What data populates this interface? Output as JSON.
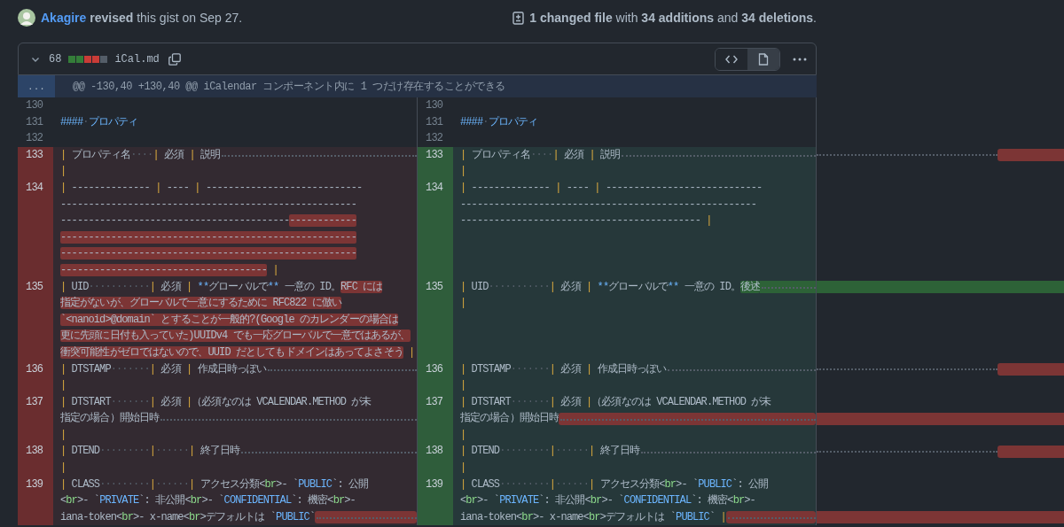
{
  "commit": {
    "author": "Akagire",
    "note": "**revised** this gist on Sep 27.",
    "summary": "**1 changed file** with **34 additions** and **34 deletions**."
  },
  "file": {
    "expanded": true,
    "changes": "68",
    "name": "iCal.md",
    "diffstat": [
      {
        "color": "#347d39"
      },
      {
        "color": "#347d39"
      },
      {
        "color": "#c93c37"
      },
      {
        "color": "#c93c37"
      },
      {
        "color": "#545d68"
      }
    ],
    "view_modes": [
      {
        "kind": "source",
        "selected": false
      },
      {
        "kind": "rich",
        "selected": true
      }
    ]
  },
  "hunk": {
    "expander": "...",
    "header": "@@ -130,40 +130,40 @@ iCalendar コンポーネント内に 1 つだけ存在することができる"
  },
  "rows": [
    {
      "left": {
        "number": "130",
        "kind": "context"
      },
      "right": {
        "number": "130",
        "kind": "context"
      }
    },
    {
      "left": {
        "number": "131",
        "kind": "context",
        "lines": [
          {
            "segments": [
              {
                "kind": "heading",
                "text": "####"
              },
              {
                "kind": "space",
                "text": "·"
              },
              {
                "kind": "heading",
                "text": "プロパティ"
              }
            ]
          }
        ]
      },
      "right": {
        "number": "131",
        "kind": "context",
        "lines": [
          {
            "segments": [
              {
                "kind": "heading",
                "text": "####"
              },
              {
                "kind": "space",
                "text": "·"
              },
              {
                "kind": "heading",
                "text": "プロパティ"
              }
            ]
          }
        ]
      }
    },
    {
      "left": {
        "number": "132",
        "kind": "context"
      },
      "right": {
        "number": "132",
        "kind": "context"
      }
    },
    {
      "left": {
        "number": "133",
        "kind": "deleted",
        "lines": [
          {
            "segments": [
              {
                "kind": "pipe",
                "text": "|"
              },
              {
                "kind": "plain",
                "text": " プロパティ名"
              },
              {
                "kind": "space",
                "text": "····"
              },
              {
                "kind": "pipe",
                "text": "|"
              },
              {
                "kind": "plain",
                "text": " 必須 "
              },
              {
                "kind": "pipe",
                "text": "|"
              },
              {
                "kind": "plain",
                "text": " 説明"
              }
            ],
            "trail": {
              "kind": "dots"
            }
          },
          {
            "segments": [
              {
                "kind": "pipe",
                "text": "|"
              }
            ]
          }
        ]
      },
      "right": {
        "number": "133",
        "kind": "added",
        "lines": [
          {
            "segments": [
              {
                "kind": "pipe",
                "text": "|"
              },
              {
                "kind": "plain",
                "text": " プロパティ名"
              },
              {
                "kind": "space",
                "text": "····"
              },
              {
                "kind": "pipe",
                "text": "|"
              },
              {
                "kind": "plain",
                "text": " 必須 "
              },
              {
                "kind": "pipe",
                "text": "|"
              },
              {
                "kind": "plain",
                "text": " 説明"
              }
            ],
            "trail": {
              "kind": "dots"
            }
          },
          {
            "segments": [
              {
                "kind": "pipe",
                "text": "|"
              }
            ]
          }
        ]
      },
      "overflow": [
        {
          "kind": "deleted"
        },
        {
          "kind": "empty"
        }
      ]
    },
    {
      "left": {
        "number": "134",
        "kind": "deleted",
        "lines": [
          {
            "segments": [
              {
                "kind": "pipe",
                "text": "|"
              },
              {
                "kind": "plain",
                "text": " -------------- "
              },
              {
                "kind": "pipe",
                "text": "|"
              },
              {
                "kind": "plain",
                "text": " ---- "
              },
              {
                "kind": "pipe",
                "text": "|"
              },
              {
                "kind": "plain",
                "text": " ----------------------------"
              }
            ]
          },
          {
            "segments": [
              {
                "kind": "plain",
                "text": "-----------------------------------------------------"
              }
            ]
          },
          {
            "segments": [
              {
                "kind": "plain",
                "text": "-----------------------------------------"
              },
              {
                "kind": "marked",
                "text": "------------"
              }
            ]
          },
          {
            "segments": [
              {
                "kind": "marked",
                "text": "-----------------------------------------------------"
              }
            ]
          },
          {
            "segments": [
              {
                "kind": "marked",
                "text": "-----------------------------------------------------"
              }
            ]
          },
          {
            "segments": [
              {
                "kind": "marked",
                "text": "-------------------------------------"
              },
              {
                "kind": "pipe",
                "text": " |"
              }
            ]
          }
        ]
      },
      "right": {
        "number": "134",
        "kind": "added",
        "lines": [
          {
            "segments": [
              {
                "kind": "pipe",
                "text": "|"
              },
              {
                "kind": "plain",
                "text": " -------------- "
              },
              {
                "kind": "pipe",
                "text": "|"
              },
              {
                "kind": "plain",
                "text": " ---- "
              },
              {
                "kind": "pipe",
                "text": "|"
              },
              {
                "kind": "plain",
                "text": " ----------------------------"
              }
            ]
          },
          {
            "segments": [
              {
                "kind": "plain",
                "text": "-----------------------------------------------------"
              }
            ]
          },
          {
            "segments": [
              {
                "kind": "plain",
                "text": "-------------------------------------------"
              },
              {
                "kind": "pipe",
                "text": " |"
              }
            ]
          }
        ]
      }
    },
    {
      "left": {
        "number": "135",
        "kind": "deleted",
        "lines": [
          {
            "segments": [
              {
                "kind": "pipe",
                "text": "|"
              },
              {
                "kind": "plain",
                "text": " UID"
              },
              {
                "kind": "space",
                "text": "···········"
              },
              {
                "kind": "pipe",
                "text": "|"
              },
              {
                "kind": "plain",
                "text": " 必須 "
              },
              {
                "kind": "pipe",
                "text": "|"
              },
              {
                "kind": "emph",
                "text": " **"
              },
              {
                "kind": "plain",
                "text": "グローバルで"
              },
              {
                "kind": "emph",
                "text": "**"
              },
              {
                "kind": "plain",
                "text": " 一意の ID。"
              },
              {
                "kind": "marked",
                "text": "RFC には"
              }
            ]
          },
          {
            "segments": [
              {
                "kind": "marked",
                "text": "指定がないが、グローバルで一意にするために RFC822 に倣い"
              }
            ]
          },
          {
            "segments": [
              {
                "kind": "marked",
                "text": "`<nanoid>@domain` とすることが一般的?(Google のカレンダーの場合は"
              }
            ]
          },
          {
            "segments": [
              {
                "kind": "marked",
                "text": "更に先頭に日付も入っていた)UUIDv4 でも一応グローバルで一意ではあるが、"
              }
            ]
          },
          {
            "segments": [
              {
                "kind": "marked",
                "text": "衝突可能性がゼロではないので、UUID だとしてもドメインはあってよさそう"
              },
              {
                "kind": "pipe",
                "text": " |"
              }
            ]
          }
        ]
      },
      "right": {
        "number": "135",
        "kind": "added",
        "lines": [
          {
            "segments": [
              {
                "kind": "pipe",
                "text": "|"
              },
              {
                "kind": "plain",
                "text": " UID"
              },
              {
                "kind": "space",
                "text": "···········"
              },
              {
                "kind": "pipe",
                "text": "|"
              },
              {
                "kind": "plain",
                "text": " 必須 "
              },
              {
                "kind": "pipe",
                "text": "|"
              },
              {
                "kind": "emph",
                "text": " **"
              },
              {
                "kind": "plain",
                "text": "グローバルで"
              },
              {
                "kind": "emph",
                "text": "**"
              },
              {
                "kind": "plain",
                "text": " 一意の ID。"
              },
              {
                "kind": "marked",
                "text": "後述"
              }
            ],
            "trail": {
              "kind": "added"
            }
          },
          {
            "segments": [
              {
                "kind": "pipe",
                "text": "|"
              }
            ]
          }
        ]
      },
      "overflow": [
        {
          "kind": "added-wide"
        },
        {
          "kind": "empty"
        },
        {
          "kind": "empty"
        },
        {
          "kind": "empty"
        },
        {
          "kind": "empty"
        }
      ]
    },
    {
      "left": {
        "number": "136",
        "kind": "deleted",
        "lines": [
          {
            "segments": [
              {
                "kind": "pipe",
                "text": "|"
              },
              {
                "kind": "plain",
                "text": " DTSTAMP"
              },
              {
                "kind": "space",
                "text": "·······"
              },
              {
                "kind": "pipe",
                "text": "|"
              },
              {
                "kind": "plain",
                "text": " 必須 "
              },
              {
                "kind": "pipe",
                "text": "|"
              },
              {
                "kind": "plain",
                "text": " 作成日時っぽい"
              }
            ],
            "trail": {
              "kind": "dots"
            }
          },
          {
            "segments": [
              {
                "kind": "pipe",
                "text": "|"
              }
            ]
          }
        ]
      },
      "right": {
        "number": "136",
        "kind": "added",
        "lines": [
          {
            "segments": [
              {
                "kind": "pipe",
                "text": "|"
              },
              {
                "kind": "plain",
                "text": " DTSTAMP"
              },
              {
                "kind": "space",
                "text": "·······"
              },
              {
                "kind": "pipe",
                "text": "|"
              },
              {
                "kind": "plain",
                "text": " 必須 "
              },
              {
                "kind": "pipe",
                "text": "|"
              },
              {
                "kind": "plain",
                "text": " 作成日時っぽい"
              }
            ],
            "trail": {
              "kind": "dots"
            }
          },
          {
            "segments": [
              {
                "kind": "pipe",
                "text": "|"
              }
            ]
          }
        ]
      },
      "overflow": [
        {
          "kind": "deleted"
        },
        {
          "kind": "empty"
        }
      ]
    },
    {
      "left": {
        "number": "137",
        "kind": "deleted",
        "lines": [
          {
            "segments": [
              {
                "kind": "pipe",
                "text": "|"
              },
              {
                "kind": "plain",
                "text": " DTSTART"
              },
              {
                "kind": "space",
                "text": "·······"
              },
              {
                "kind": "pipe",
                "text": "|"
              },
              {
                "kind": "plain",
                "text": " 必須 "
              },
              {
                "kind": "pipe",
                "text": "|"
              },
              {
                "kind": "plain",
                "text": "（必須なのは VCALENDAR.METHOD が未"
              }
            ]
          },
          {
            "segments": [
              {
                "kind": "plain",
                "text": "指定の場合）開始日時"
              }
            ],
            "trail": {
              "kind": "dots"
            }
          },
          {
            "segments": [
              {
                "kind": "pipe",
                "text": "|"
              }
            ]
          }
        ]
      },
      "right": {
        "number": "137",
        "kind": "added",
        "lines": [
          {
            "segments": [
              {
                "kind": "pipe",
                "text": "|"
              },
              {
                "kind": "plain",
                "text": " DTSTART"
              },
              {
                "kind": "space",
                "text": "·······"
              },
              {
                "kind": "pipe",
                "text": "|"
              },
              {
                "kind": "plain",
                "text": " 必須 "
              },
              {
                "kind": "pipe",
                "text": "|"
              },
              {
                "kind": "plain",
                "text": "（必須なのは VCALENDAR.METHOD が未"
              }
            ]
          },
          {
            "segments": [
              {
                "kind": "plain",
                "text": "指定の場合）開始日時"
              }
            ],
            "trail": {
              "kind": "deleted"
            }
          },
          {
            "segments": [
              {
                "kind": "pipe",
                "text": "|"
              }
            ]
          }
        ]
      },
      "overflow": [
        {
          "kind": "empty"
        },
        {
          "kind": "deleted-wide"
        },
        {
          "kind": "empty"
        }
      ]
    },
    {
      "left": {
        "number": "138",
        "kind": "deleted",
        "lines": [
          {
            "segments": [
              {
                "kind": "pipe",
                "text": "|"
              },
              {
                "kind": "plain",
                "text": " DTEND"
              },
              {
                "kind": "space",
                "text": "·········"
              },
              {
                "kind": "pipe",
                "text": "|"
              },
              {
                "kind": "space",
                "text": "······"
              },
              {
                "kind": "pipe",
                "text": "|"
              },
              {
                "kind": "plain",
                "text": " 終了日時"
              }
            ],
            "trail": {
              "kind": "dots"
            }
          },
          {
            "segments": [
              {
                "kind": "pipe",
                "text": "|"
              }
            ]
          }
        ]
      },
      "right": {
        "number": "138",
        "kind": "added",
        "lines": [
          {
            "segments": [
              {
                "kind": "pipe",
                "text": "|"
              },
              {
                "kind": "plain",
                "text": " DTEND"
              },
              {
                "kind": "space",
                "text": "·········"
              },
              {
                "kind": "pipe",
                "text": "|"
              },
              {
                "kind": "space",
                "text": "······"
              },
              {
                "kind": "pipe",
                "text": "|"
              },
              {
                "kind": "plain",
                "text": " 終了日時"
              }
            ],
            "trail": {
              "kind": "dots"
            }
          },
          {
            "segments": [
              {
                "kind": "pipe",
                "text": "|"
              }
            ]
          }
        ]
      },
      "overflow": [
        {
          "kind": "deleted"
        },
        {
          "kind": "empty"
        }
      ]
    },
    {
      "left": {
        "number": "139",
        "kind": "deleted",
        "lines": [
          {
            "segments": [
              {
                "kind": "pipe",
                "text": "|"
              },
              {
                "kind": "plain",
                "text": " CLASS"
              },
              {
                "kind": "space",
                "text": "·········"
              },
              {
                "kind": "pipe",
                "text": "|"
              },
              {
                "kind": "space",
                "text": "······"
              },
              {
                "kind": "pipe",
                "text": "|"
              },
              {
                "kind": "plain",
                "text": " アクセス分類<"
              },
              {
                "kind": "tag",
                "text": "br"
              },
              {
                "kind": "plain",
                "text": ">- `"
              },
              {
                "kind": "code",
                "text": "PUBLIC"
              },
              {
                "kind": "plain",
                "text": "`: 公開"
              }
            ]
          },
          {
            "segments": [
              {
                "kind": "plain",
                "text": "<"
              },
              {
                "kind": "tag",
                "text": "br"
              },
              {
                "kind": "plain",
                "text": ">- `"
              },
              {
                "kind": "code",
                "text": "PRIVATE"
              },
              {
                "kind": "plain",
                "text": "`: 非公開<"
              },
              {
                "kind": "tag",
                "text": "br"
              },
              {
                "kind": "plain",
                "text": ">- `"
              },
              {
                "kind": "code",
                "text": "CONFIDENTIAL"
              },
              {
                "kind": "plain",
                "text": "`: 機密<"
              },
              {
                "kind": "tag",
                "text": "br"
              },
              {
                "kind": "plain",
                "text": ">-"
              }
            ]
          },
          {
            "segments": [
              {
                "kind": "plain",
                "text": "iana-token<"
              },
              {
                "kind": "tag",
                "text": "br"
              },
              {
                "kind": "plain",
                "text": ">- x-name<"
              },
              {
                "kind": "tag",
                "text": "br"
              },
              {
                "kind": "plain",
                "text": ">デフォルトは `"
              },
              {
                "kind": "code",
                "text": "PUBLIC"
              },
              {
                "kind": "plain",
                "text": "`"
              }
            ],
            "trail": {
              "kind": "deleted"
            }
          }
        ]
      },
      "right": {
        "number": "139",
        "kind": "added",
        "lines": [
          {
            "segments": [
              {
                "kind": "pipe",
                "text": "|"
              },
              {
                "kind": "plain",
                "text": " CLASS"
              },
              {
                "kind": "space",
                "text": "·········"
              },
              {
                "kind": "pipe",
                "text": "|"
              },
              {
                "kind": "space",
                "text": "······"
              },
              {
                "kind": "pipe",
                "text": "|"
              },
              {
                "kind": "plain",
                "text": " アクセス分類<"
              },
              {
                "kind": "tag",
                "text": "br"
              },
              {
                "kind": "plain",
                "text": ">- `"
              },
              {
                "kind": "code",
                "text": "PUBLIC"
              },
              {
                "kind": "plain",
                "text": "`: 公開"
              }
            ]
          },
          {
            "segments": [
              {
                "kind": "plain",
                "text": "<"
              },
              {
                "kind": "tag",
                "text": "br"
              },
              {
                "kind": "plain",
                "text": ">- `"
              },
              {
                "kind": "code",
                "text": "PRIVATE"
              },
              {
                "kind": "plain",
                "text": "`: 非公開<"
              },
              {
                "kind": "tag",
                "text": "br"
              },
              {
                "kind": "plain",
                "text": ">- `"
              },
              {
                "kind": "code",
                "text": "CONFIDENTIAL"
              },
              {
                "kind": "plain",
                "text": "`: 機密<"
              },
              {
                "kind": "tag",
                "text": "br"
              },
              {
                "kind": "plain",
                "text": ">-"
              }
            ]
          },
          {
            "segments": [
              {
                "kind": "plain",
                "text": "iana-token<"
              },
              {
                "kind": "tag",
                "text": "br"
              },
              {
                "kind": "plain",
                "text": ">- x-name<"
              },
              {
                "kind": "tag",
                "text": "br"
              },
              {
                "kind": "plain",
                "text": ">デフォルトは `"
              },
              {
                "kind": "code",
                "text": "PUBLIC"
              },
              {
                "kind": "plain",
                "text": "` "
              },
              {
                "kind": "pipe",
                "text": "|"
              }
            ],
            "trail": {
              "kind": "deleted"
            }
          }
        ]
      },
      "overflow": [
        {
          "kind": "empty"
        },
        {
          "kind": "empty"
        },
        {
          "kind": "deleted-wide"
        }
      ]
    }
  ]
}
